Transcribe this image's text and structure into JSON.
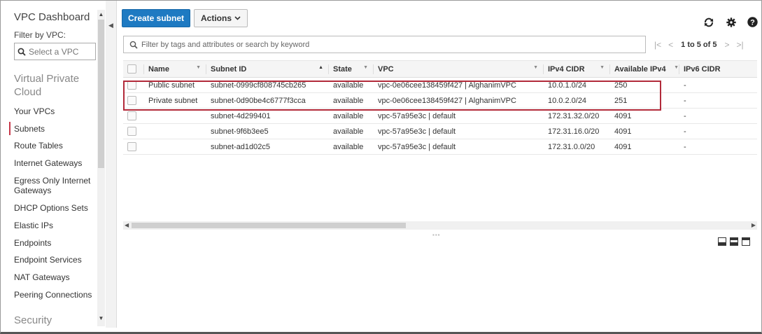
{
  "sidebar": {
    "title": "VPC Dashboard",
    "filter_label": "Filter by VPC:",
    "select_placeholder": "Select a VPC",
    "section_vpc": "Virtual Private Cloud",
    "items": [
      {
        "label": "Your VPCs"
      },
      {
        "label": "Subnets",
        "active": true
      },
      {
        "label": "Route Tables"
      },
      {
        "label": "Internet Gateways"
      },
      {
        "label": "Egress Only Internet Gateways"
      },
      {
        "label": "DHCP Options Sets"
      },
      {
        "label": "Elastic IPs"
      },
      {
        "label": "Endpoints"
      },
      {
        "label": "Endpoint Services"
      },
      {
        "label": "NAT Gateways"
      },
      {
        "label": "Peering Connections"
      }
    ],
    "section_security": "Security"
  },
  "toolbar": {
    "create_label": "Create subnet",
    "actions_label": "Actions"
  },
  "icons": {
    "refresh": "refresh-icon",
    "settings": "gear-icon",
    "help": "help-icon"
  },
  "filter": {
    "placeholder": "Filter by tags and attributes or search by keyword"
  },
  "pager": {
    "text": "1 to 5 of 5"
  },
  "table": {
    "columns": [
      "Name",
      "Subnet ID",
      "State",
      "VPC",
      "IPv4 CIDR",
      "Available IPv4",
      "IPv6 CIDR"
    ],
    "rows": [
      {
        "name": "Public subnet",
        "subnet_id": "subnet-0999cf808745cb265",
        "state": "available",
        "vpc": "vpc-0e06cee138459f427 | AlghanimVPC",
        "ipv4": "10.0.1.0/24",
        "available": "250",
        "ipv6": "-"
      },
      {
        "name": "Private subnet",
        "subnet_id": "subnet-0d90be4c6777f3cca",
        "state": "available",
        "vpc": "vpc-0e06cee138459f427 | AlghanimVPC",
        "ipv4": "10.0.2.0/24",
        "available": "251",
        "ipv6": "-"
      },
      {
        "name": "",
        "subnet_id": "subnet-4d299401",
        "state": "available",
        "vpc": "vpc-57a95e3c | default",
        "ipv4": "172.31.32.0/20",
        "available": "4091",
        "ipv6": "-"
      },
      {
        "name": "",
        "subnet_id": "subnet-9f6b3ee5",
        "state": "available",
        "vpc": "vpc-57a95e3c | default",
        "ipv4": "172.31.16.0/20",
        "available": "4091",
        "ipv6": "-"
      },
      {
        "name": "",
        "subnet_id": "subnet-ad1d02c5",
        "state": "available",
        "vpc": "vpc-57a95e3c | default",
        "ipv4": "172.31.0.0/20",
        "available": "4091",
        "ipv6": "-"
      }
    ]
  },
  "colors": {
    "primary": "#1e7ac2",
    "highlight": "#b22a3a",
    "active_marker": "#c7384a"
  }
}
